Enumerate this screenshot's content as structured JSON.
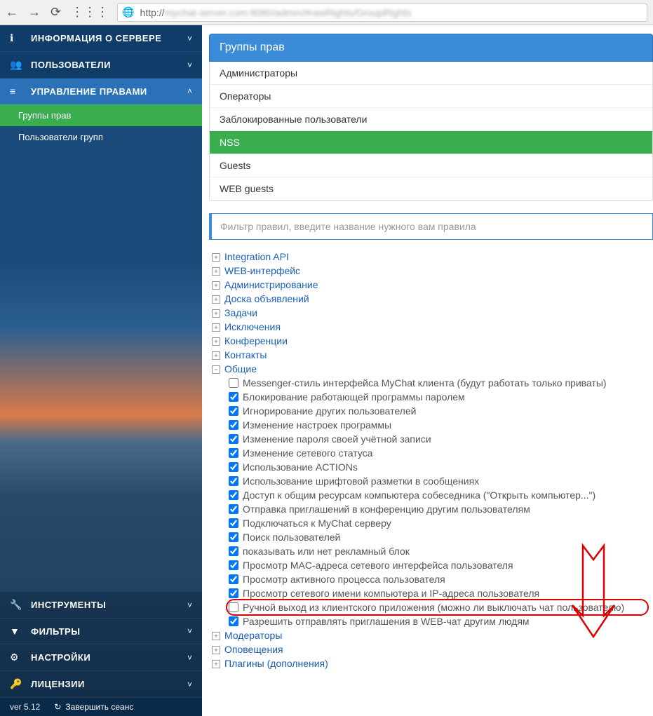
{
  "browser": {
    "url_prefix": "http://",
    "url_blurred": "mychat-server.com:8080/admin/#rawRights/GroupRights"
  },
  "sidebar": {
    "items": [
      {
        "icon": "ℹ",
        "label": "ИНФОРМАЦИЯ О СЕРВЕРЕ",
        "chev": "˅"
      },
      {
        "icon": "👥",
        "label": "ПОЛЬЗОВАТЕЛИ",
        "chev": "˅"
      },
      {
        "icon": "≡",
        "label": "УПРАВЛЕНИЕ ПРАВАМИ",
        "chev": "˄",
        "active": true
      }
    ],
    "sub": [
      {
        "label": "Группы прав",
        "selected": true
      },
      {
        "label": "Пользователи групп",
        "selected": false
      }
    ],
    "bottom": [
      {
        "icon": "🔧",
        "label": "ИНСТРУМЕНТЫ",
        "chev": "˅"
      },
      {
        "icon": "▼",
        "label": "ФИЛЬТРЫ",
        "chev": "˅"
      },
      {
        "icon": "⚙",
        "label": "НАСТРОЙКИ",
        "chev": "˅"
      },
      {
        "icon": "🔑",
        "label": "ЛИЦЕНЗИИ",
        "chev": "˅"
      }
    ]
  },
  "footer": {
    "version": "ver 5.12",
    "logout": "Завершить сеанс"
  },
  "panel": {
    "title": "Группы прав"
  },
  "groups": [
    {
      "label": "Администраторы",
      "selected": false
    },
    {
      "label": "Операторы",
      "selected": false
    },
    {
      "label": "Заблокированные пользователи",
      "selected": false
    },
    {
      "label": "NSS",
      "selected": true
    },
    {
      "label": "Guests",
      "selected": false
    },
    {
      "label": "WEB guests",
      "selected": false
    }
  ],
  "filter": {
    "placeholder": "Фильтр правил, введите название нужного вам правила"
  },
  "tree": {
    "collapsed": [
      "Integration API",
      "WEB-интерфейс",
      "Администрирование",
      "Доска объявлений",
      "Задачи",
      "Исключения",
      "Конференции",
      "Контакты"
    ],
    "expanded_label": "Общие",
    "rules": [
      {
        "checked": false,
        "label": "Messenger-стиль интерфейса MyChat клиента (будут работать только приваты)"
      },
      {
        "checked": true,
        "label": "Блокирование работающей программы паролем"
      },
      {
        "checked": true,
        "label": "Игнорирование других пользователей"
      },
      {
        "checked": true,
        "label": "Изменение настроек программы"
      },
      {
        "checked": true,
        "label": "Изменение пароля своей учётной записи"
      },
      {
        "checked": true,
        "label": "Изменение сетевого статуса"
      },
      {
        "checked": true,
        "label": "Использование ACTIONs"
      },
      {
        "checked": true,
        "label": "Использование шрифтовой разметки в сообщениях"
      },
      {
        "checked": true,
        "label": "Доступ к общим ресурсам компьютера собеседника (\"Открыть компьютер...\")"
      },
      {
        "checked": true,
        "label": "Отправка приглашений в конференцию другим пользователям"
      },
      {
        "checked": true,
        "label": "Подключаться к MyChat серверу"
      },
      {
        "checked": true,
        "label": "Поиск пользователей"
      },
      {
        "checked": true,
        "label": "показывать или нет рекламный блок"
      },
      {
        "checked": true,
        "label": "Просмотр MAC-адреса сетевого интерфейса пользователя"
      },
      {
        "checked": true,
        "label": "Просмотр активного процесса пользователя"
      },
      {
        "checked": true,
        "label": "Просмотр сетевого имени компьютера и IP-адреса пользователя"
      },
      {
        "checked": false,
        "label": "Ручной выход из клиентского приложения (можно ли выключать чат пользователю)",
        "highlight": true
      },
      {
        "checked": true,
        "label": "Разрешить отправлять приглашения в WEB-чат другим людям"
      }
    ],
    "collapsed_after": [
      "Модераторы",
      "Оповещения",
      "Плагины (дополнения)"
    ]
  }
}
